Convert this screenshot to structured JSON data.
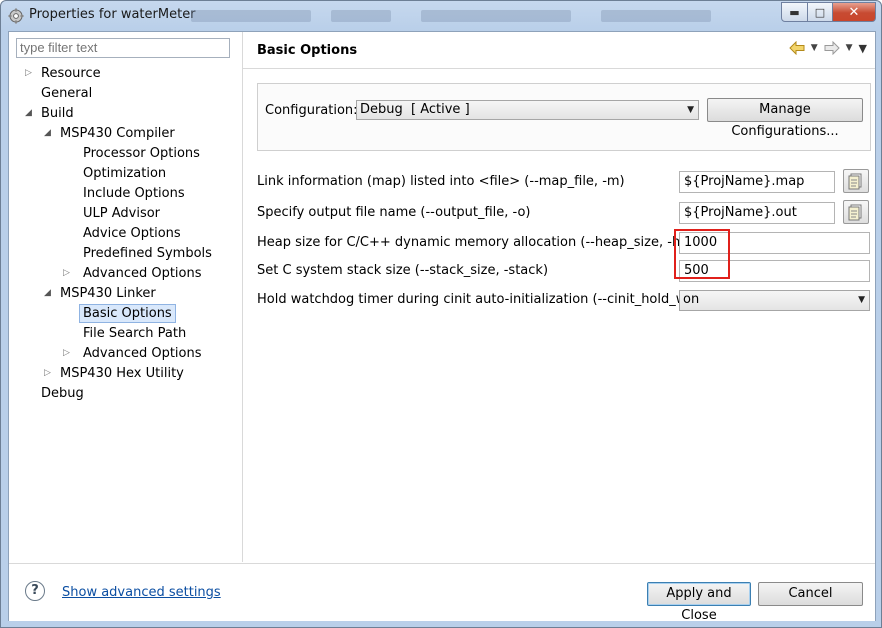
{
  "window": {
    "title": "Properties for waterMeter"
  },
  "filter": {
    "placeholder": "type filter text"
  },
  "tree": [
    {
      "label": "Resource",
      "level": 0,
      "expander": "closed"
    },
    {
      "label": "General",
      "level": 0,
      "expander": "none"
    },
    {
      "label": "Build",
      "level": 0,
      "expander": "open"
    },
    {
      "label": "MSP430 Compiler",
      "level": 1,
      "expander": "open"
    },
    {
      "label": "Processor Options",
      "level": 2,
      "expander": "none"
    },
    {
      "label": "Optimization",
      "level": 2,
      "expander": "none"
    },
    {
      "label": "Include Options",
      "level": 2,
      "expander": "none"
    },
    {
      "label": "ULP Advisor",
      "level": 2,
      "expander": "none"
    },
    {
      "label": "Advice Options",
      "level": 2,
      "expander": "none"
    },
    {
      "label": "Predefined Symbols",
      "level": 2,
      "expander": "none"
    },
    {
      "label": "Advanced Options",
      "level": 2,
      "expander": "closed"
    },
    {
      "label": "MSP430 Linker",
      "level": 1,
      "expander": "open"
    },
    {
      "label": "Basic Options",
      "level": 2,
      "expander": "none",
      "selected": true
    },
    {
      "label": "File Search Path",
      "level": 2,
      "expander": "none"
    },
    {
      "label": "Advanced Options",
      "level": 2,
      "expander": "closed"
    },
    {
      "label": "MSP430 Hex Utility",
      "level": 1,
      "expander": "closed"
    },
    {
      "label": "Debug",
      "level": 0,
      "expander": "none"
    }
  ],
  "page": {
    "title": "Basic Options",
    "nav_icons": [
      "back-arrow-icon",
      "forward-arrow-icon",
      "menu-icon"
    ]
  },
  "configuration": {
    "label": "Configuration:",
    "selected": "Debug  [ Active ]",
    "manage_button": "Manage Configurations..."
  },
  "options": [
    {
      "label": "Link information (map) listed into <file> (--map_file, -m)",
      "value": "${ProjName}.map",
      "browse": true
    },
    {
      "label": "Specify output file name (--output_file, -o)",
      "value": "${ProjName}.out",
      "browse": true
    },
    {
      "label": "Heap size for C/C++ dynamic memory allocation (--heap_size, -heap)",
      "value": "1000",
      "browse": false
    },
    {
      "label": "Set C system stack size (--stack_size, -stack)",
      "value": "500",
      "browse": false
    },
    {
      "label": "Hold watchdog timer during cinit auto-initialization (--cinit_hold_wdt)",
      "value": "on",
      "combo": true
    }
  ],
  "footer": {
    "help_icon": "help-icon",
    "advanced_link": "Show advanced settings",
    "apply_close": "Apply and Close",
    "cancel": "Cancel"
  },
  "colors": {
    "highlight": "#e0201b",
    "link": "#0b4ea2",
    "selection": "#d9e8fb"
  }
}
